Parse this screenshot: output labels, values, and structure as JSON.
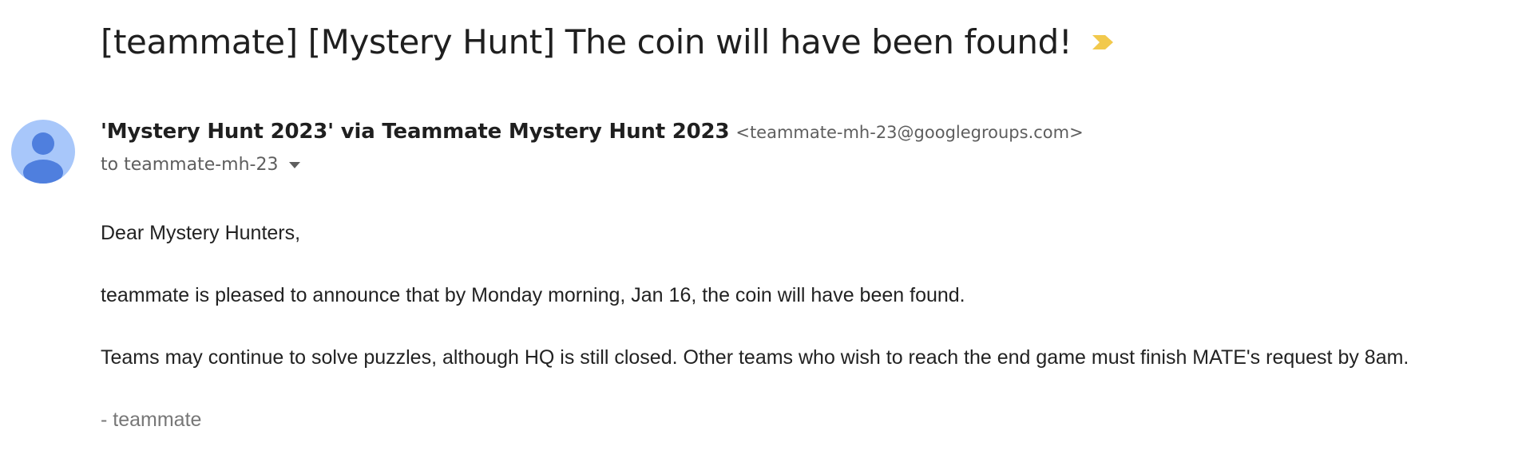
{
  "email": {
    "subject": "[teammate] [Mystery Hunt] The coin will have been found!",
    "important_color": "#f2c94c",
    "avatar_color": "#a8c7fa",
    "avatar_icon_color": "#4f7fde",
    "sender": {
      "name": "'Mystery Hunt 2023' via Teammate Mystery Hunt 2023",
      "email": "<teammate-mh-23@googlegroups.com>"
    },
    "recipient": "to teammate-mh-23",
    "body": {
      "greeting": "Dear Mystery Hunters,",
      "paragraph1": "teammate is pleased to announce that by Monday morning, Jan 16, the coin will have been found.",
      "paragraph2": "Teams may continue to solve puzzles, although HQ is still closed. Other teams who wish to reach the end game must finish MATE's request by 8am.",
      "signature": "- teammate"
    }
  }
}
